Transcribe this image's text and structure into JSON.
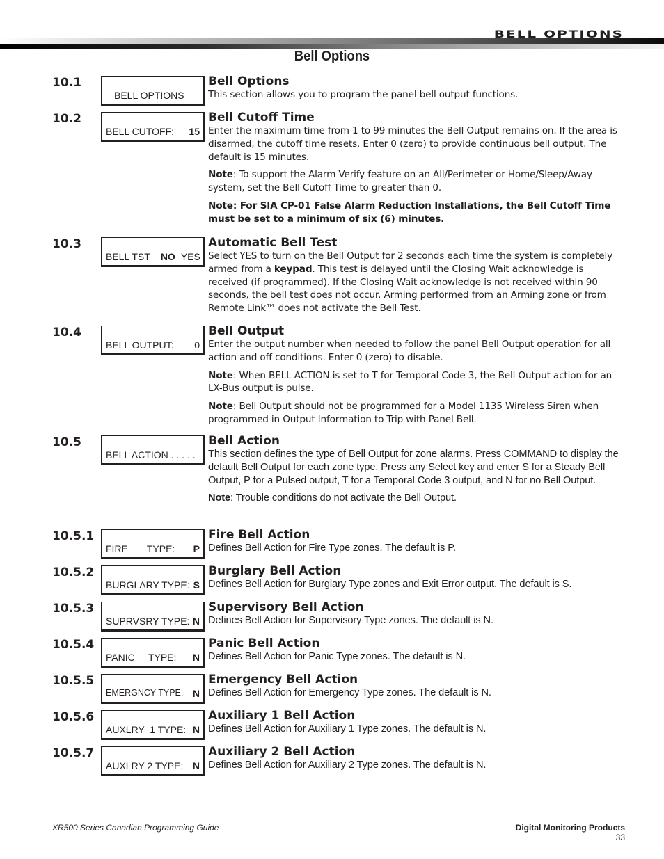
{
  "header": {
    "chapter_title": "BELL OPTIONS",
    "page_title": "Bell Options"
  },
  "sections": [
    {
      "number": "10.1",
      "lcd": {
        "label": "BELL OPTIONS",
        "value": ""
      },
      "heading": "Bell Options",
      "paragraphs": [
        "This section allows you to program the panel bell output functions."
      ]
    },
    {
      "number": "10.2",
      "lcd": {
        "label": "BELL CUTOFF:",
        "value": "15"
      },
      "heading": "Bell Cutoff Time",
      "paragraphs": [
        "Enter the maximum time from 1 to 99 minutes the Bell Output remains on.  If the area is disarmed, the cutoff time resets.  Enter 0 (zero) to provide continuous bell output.  The default is 15 minutes."
      ],
      "notes": [
        {
          "label": "Note",
          "text": ": To support the Alarm Verify feature on an All/Perimeter or Home/Sleep/Away system, set the Bell Cutoff Time to greater than 0."
        },
        {
          "label": "Note: For SIA CP-01 False Alarm Reduction Installations, the Bell Cutoff Time must be set to a minimum of six (6) minutes.",
          "text": ""
        }
      ]
    },
    {
      "number": "10.3",
      "lcd": {
        "label": "BELL TST",
        "selected": "NO",
        "other": "YES"
      },
      "heading": "Automatic Bell Test",
      "paragraph_parts": {
        "before": "Select YES to turn on the Bell Output for 2 seconds each time the system is completely armed from a ",
        "bold": "keypad",
        "after": ".  This test is delayed until the Closing Wait acknowledge is received (if programmed).  If the Closing Wait acknowledge is not received within 90 seconds, the bell test does not occur.  Arming performed from an Arming zone or from Remote Link™ does not activate the Bell Test."
      }
    },
    {
      "number": "10.4",
      "lcd": {
        "label": "BELL OUTPUT:",
        "value": "0"
      },
      "heading": "Bell Output",
      "paragraphs": [
        "Enter the output number when needed to follow the panel Bell Output operation for all action and off conditions.  Enter 0 (zero) to disable."
      ],
      "notes": [
        {
          "label": "Note",
          "text": ": When BELL ACTION is set to T for Temporal Code 3, the Bell Output action for an LX-Bus output is pulse."
        },
        {
          "label": "Note",
          "text": ": Bell Output should not be programmed for a Model 1135 Wireless Siren when programmed in Output Information to Trip with Panel Bell."
        }
      ]
    },
    {
      "number": "10.5",
      "lcd": {
        "label": "BELL ACTION . . . . .",
        "value": ""
      },
      "heading": "Bell Action",
      "paragraphs": [
        "This section defines the type of Bell Output for zone alarms.  Press COMMAND to display the default Bell Output for each zone type.  Press any Select key and enter S for a Steady Bell Output, P for a Pulsed output, T for a Temporal Code 3 output, and N for no Bell Output."
      ],
      "notes": [
        {
          "label": "Note",
          "text": ": Trouble conditions do not activate the Bell Output."
        }
      ]
    },
    {
      "number": "10.5.1",
      "lcd": {
        "label": "FIRE       TYPE:",
        "value": "P"
      },
      "heading": "Fire Bell Action",
      "paragraphs": [
        "Defines Bell Action for Fire Type zones.  The default is P."
      ]
    },
    {
      "number": "10.5.2",
      "lcd": {
        "label": "BURGLARY TYPE:",
        "value": "S"
      },
      "heading": "Burglary Bell Action",
      "paragraphs": [
        "Defines Bell Action for Burglary Type zones and Exit Error output.  The default is S."
      ]
    },
    {
      "number": "10.5.3",
      "lcd": {
        "label": "SUPRVSRY TYPE:",
        "value": "N"
      },
      "heading": "Supervisory Bell Action",
      "paragraphs": [
        "Defines Bell Action for Supervisory Type zones.  The default is N."
      ]
    },
    {
      "number": "10.5.4",
      "lcd": {
        "label": "PANIC     TYPE:",
        "value": "N"
      },
      "heading": "Panic Bell Action",
      "paragraphs": [
        "Defines Bell Action for Panic Type zones.  The default is N."
      ]
    },
    {
      "number": "10.5.5",
      "lcd": {
        "label": "EMERGNCY TYPE:",
        "value": "N"
      },
      "heading": "Emergency Bell Action",
      "paragraphs": [
        "Defines Bell Action for Emergency Type zones.  The default is N."
      ]
    },
    {
      "number": "10.5.6",
      "lcd": {
        "label": "AUXLRY  1 TYPE:",
        "value": "N"
      },
      "heading": "Auxiliary 1 Bell Action",
      "paragraphs": [
        "Defines Bell Action for Auxiliary 1 Type zones.  The default is N."
      ]
    },
    {
      "number": "10.5.7",
      "lcd": {
        "label": "AUXLRY 2 TYPE:",
        "value": "N"
      },
      "heading": "Auxiliary 2 Bell Action",
      "paragraphs": [
        "Defines Bell Action for Auxiliary 2 Type zones.  The default is N."
      ]
    }
  ],
  "footer": {
    "guide_title": "XR500 Series Canadian Programming Guide",
    "company": "Digital Monitoring Products",
    "page_number": "33"
  }
}
